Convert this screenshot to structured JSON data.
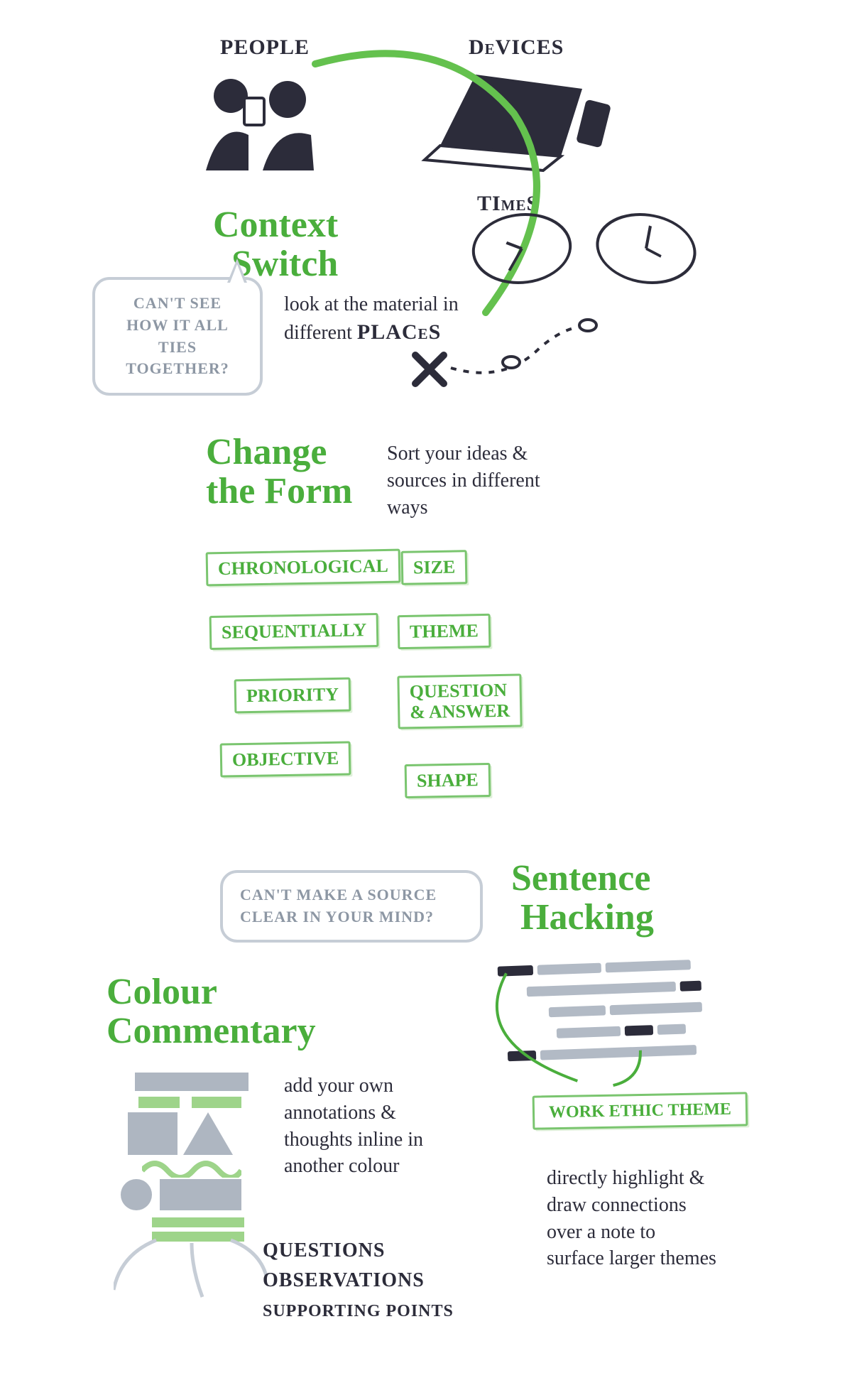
{
  "contextIcons": {
    "people": "PEOPLE",
    "devices": "DeVICES",
    "times": "TImeS",
    "places": "PLACeS"
  },
  "contextSwitch": {
    "title1": "Context",
    "title2": "Switch",
    "body": "look at the material in different"
  },
  "bubble1": "CAN'T SEE HOW IT ALL TIES TOGETHER?",
  "changeForm": {
    "title1": "Change",
    "title2": "the Form",
    "body": "Sort your ideas & sources in different ways",
    "tags": {
      "chrono": "CHRONOLOGICAL",
      "seq": "SEQUENTIALLY",
      "prio": "PRIORITY",
      "obj": "OBJECTIVE",
      "size": "SIZE",
      "theme": "THEME",
      "qa1": "QUESTION",
      "qa2": "& ANSWER",
      "shape": "SHAPE"
    }
  },
  "bubble2": "CAN'T MAKE A SOURCE CLEAR IN YOUR MIND?",
  "colourCommentary": {
    "title1": "Colour",
    "title2": "Commentary",
    "body": "add your own annotations & thoughts inline in another colour",
    "list": {
      "q": "QUESTIONS",
      "o": "OBSERVATIONS",
      "s": "SUPPORTING POINTS"
    }
  },
  "sentenceHacking": {
    "title1": "Sentence",
    "title2": "Hacking",
    "label": "WORK ETHIC THEME",
    "body": "directly highlight & draw connections over a note to surface larger themes"
  }
}
